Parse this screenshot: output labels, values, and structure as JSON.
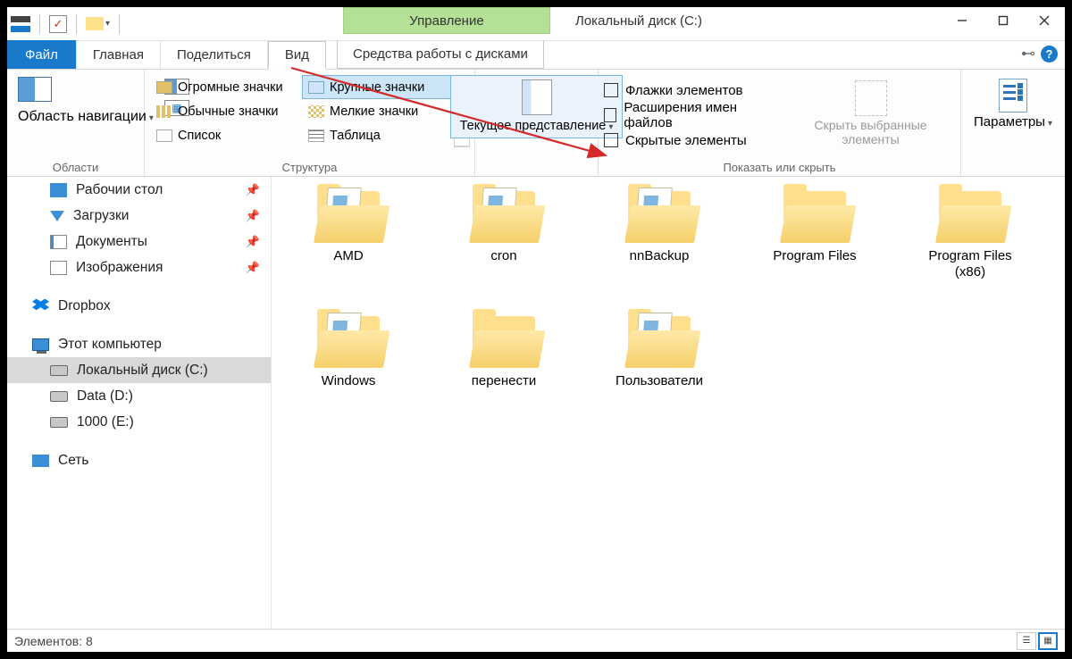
{
  "titlebar": {
    "context_tab": "Управление",
    "window_title": "Локальный диск (C:)"
  },
  "tabs": {
    "file": "Файл",
    "home": "Главная",
    "share": "Поделиться",
    "view": "Вид",
    "context": "Средства работы с дисками"
  },
  "ribbon": {
    "panes_group": "Области",
    "nav_pane": "Область навигации",
    "layout_group": "Структура",
    "layout": {
      "xlarge": "Огромные значки",
      "large": "Крупные значки",
      "medium": "Обычные значки",
      "small": "Мелкие значки",
      "list": "Список",
      "details": "Таблица"
    },
    "current_view": "Текущее представление",
    "showhide_group": "Показать или скрыть",
    "check_boxes": "Флажки элементов",
    "extensions": "Расширения имен файлов",
    "hidden": "Скрытые элементы",
    "hide_selected": "Скрыть выбранные элементы",
    "options": "Параметры"
  },
  "sidebar": {
    "desktop": "Рабочии стол",
    "downloads": "Загрузки",
    "documents": "Документы",
    "pictures": "Изображения",
    "dropbox": "Dropbox",
    "this_pc": "Этот компьютер",
    "drive_c": "Локальный диск (C:)",
    "drive_d": "Data (D:)",
    "drive_e": "1000 (E:)",
    "network": "Сеть"
  },
  "folders": {
    "0": "AMD",
    "1": "cron",
    "2": "nnBackup",
    "3": "Program Files",
    "4": "Program Files (x86)",
    "5": "Windows",
    "6": "перенести",
    "7": "Пользователи"
  },
  "status": {
    "count_label": "Элементов: 8"
  }
}
